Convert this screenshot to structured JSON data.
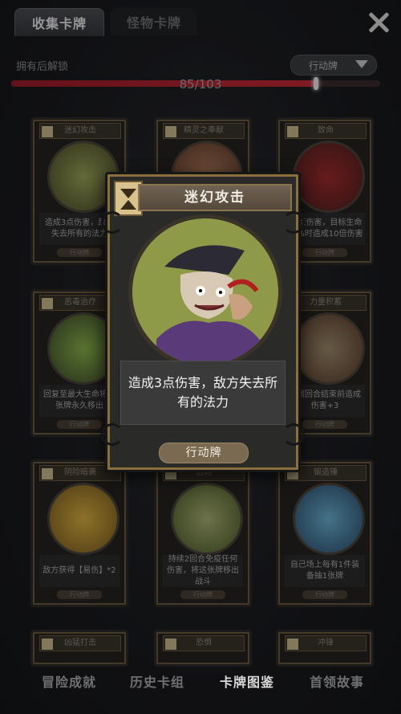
{
  "tabs": [
    {
      "label": "收集卡牌",
      "active": true
    },
    {
      "label": "怪物卡牌",
      "active": false
    }
  ],
  "owned_label": "拥有后解锁",
  "filter": {
    "label": "行动牌",
    "icon": "funnel-icon"
  },
  "progress": {
    "text": "85/103",
    "owned": 85,
    "total": 103,
    "fill_fraction": 0.8252
  },
  "grid_cards": [
    {
      "name": "迷幻攻击",
      "desc": "造成3点伤害，敌方失去所有的法力",
      "type": "行动牌"
    },
    {
      "name": "精灵之奉献",
      "desc": "",
      "type": "行动牌"
    },
    {
      "name": "致命",
      "desc": "12点伤害，目标生命30%时造成10倍伤害",
      "type": "行动牌"
    },
    {
      "name": "恶毒治疗",
      "desc": "回复至最大生命将这张牌永久移出",
      "type": "行动牌"
    },
    {
      "name": "",
      "desc": "",
      "type": ""
    },
    {
      "name": "力量积蓄",
      "desc": "直到回合结束前造成伤害+3",
      "type": "行动牌"
    },
    {
      "name": "阴险暗袭",
      "desc": "敌方获得【易伤】*2",
      "type": "行动牌"
    },
    {
      "name": "逃跑",
      "desc": "持续2回合免疫任何伤害，将这张牌移出战斗",
      "type": "行动牌"
    },
    {
      "name": "锻造锤",
      "desc": "自己场上每有1件装备抽1张牌",
      "type": "行动牌"
    },
    {
      "name": "凶猛打击",
      "desc": "",
      "type": ""
    },
    {
      "name": "恐惧",
      "desc": "",
      "type": ""
    },
    {
      "name": "冲锋",
      "desc": "",
      "type": ""
    }
  ],
  "selected_card": {
    "name": "迷幻攻击",
    "desc": "造成3点伤害，敌方失去所有的法力",
    "type": "行动牌"
  },
  "bottom_nav": [
    {
      "label": "冒险成就",
      "active": false
    },
    {
      "label": "历史卡组",
      "active": false
    },
    {
      "label": "卡牌图鉴",
      "active": true
    },
    {
      "label": "首领故事",
      "active": false
    }
  ]
}
